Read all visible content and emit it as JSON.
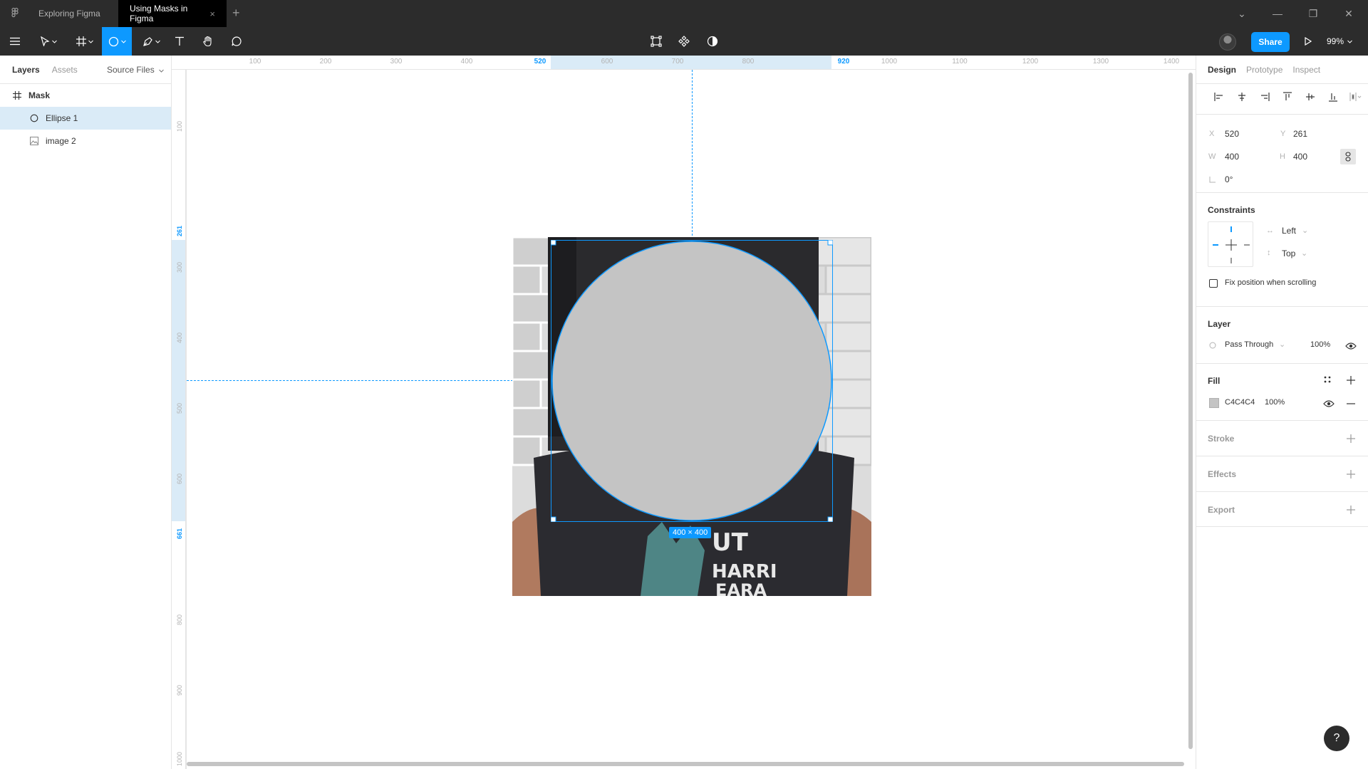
{
  "tabs": [
    {
      "label": "Exploring Figma"
    },
    {
      "label": "Using Masks in Figma"
    }
  ],
  "toolbar": {
    "share_label": "Share",
    "zoom": "99%",
    "tools": [
      "main-menu-icon",
      "move-tool-icon",
      "frame-tool-icon",
      "ellipse-tool-icon",
      "pen-tool-icon",
      "text-tool-icon",
      "hand-tool-icon",
      "comment-tool-icon"
    ],
    "center_tools": [
      "create-component-icon",
      "components-icon",
      "contrast-icon"
    ]
  },
  "left_panel": {
    "tabs": {
      "layers": "Layers",
      "assets": "Assets"
    },
    "page_selector": "Source Files",
    "layers": [
      {
        "name": "Mask",
        "icon": "frame-icon"
      },
      {
        "name": "Ellipse 1",
        "icon": "ellipse-icon"
      },
      {
        "name": "image 2",
        "icon": "image-icon"
      }
    ]
  },
  "rulers": {
    "top": [
      {
        "label": "100"
      },
      {
        "label": "200"
      },
      {
        "label": "300"
      },
      {
        "label": "400"
      },
      {
        "label": "520",
        "hl": true
      },
      {
        "label": "600"
      },
      {
        "label": "700"
      },
      {
        "label": "800"
      },
      {
        "label": "920",
        "hl": true
      },
      {
        "label": "1000"
      },
      {
        "label": "1100"
      },
      {
        "label": "1200"
      },
      {
        "label": "1300"
      },
      {
        "label": "1400"
      }
    ],
    "left": [
      {
        "label": "100"
      },
      {
        "label": "261",
        "hl": true
      },
      {
        "label": "300"
      },
      {
        "label": "400"
      },
      {
        "label": "500"
      },
      {
        "label": "600"
      },
      {
        "label": "661",
        "hl": true
      },
      {
        "label": "800"
      },
      {
        "label": "900"
      },
      {
        "label": "1000"
      }
    ]
  },
  "canvas": {
    "size_badge": "400 × 400",
    "ellipse_fill": "#C4C4C4",
    "selection_color": "#0D99FF"
  },
  "right_panel": {
    "tabs": {
      "design": "Design",
      "prototype": "Prototype",
      "inspect": "Inspect"
    },
    "position": {
      "x_label": "X",
      "x": "520",
      "y_label": "Y",
      "y": "261",
      "w_label": "W",
      "w": "400",
      "h_label": "H",
      "h": "400",
      "rotation": "0°"
    },
    "constraints": {
      "title": "Constraints",
      "horizontal": "Left",
      "vertical": "Top",
      "fix_position": "Fix position when scrolling"
    },
    "layer": {
      "title": "Layer",
      "blend": "Pass Through",
      "opacity": "100%"
    },
    "fill": {
      "title": "Fill",
      "hex": "C4C4C4",
      "opacity": "100%",
      "swatch": "#C4C4C4"
    },
    "stroke": {
      "title": "Stroke"
    },
    "effects": {
      "title": "Effects"
    },
    "export": {
      "title": "Export"
    }
  },
  "help_label": "?"
}
